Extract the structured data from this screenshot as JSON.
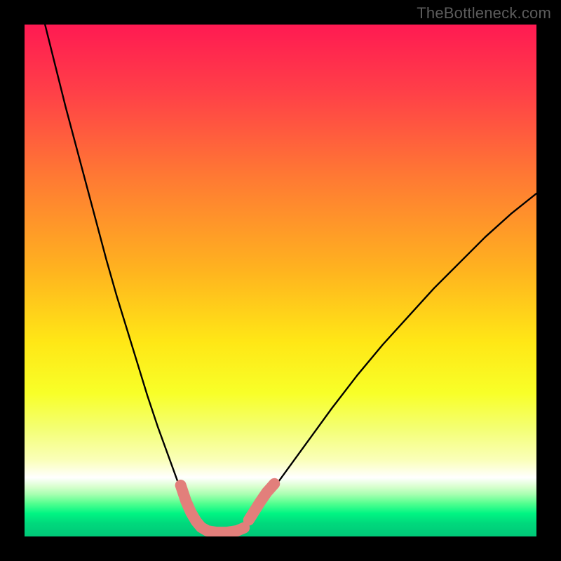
{
  "watermark": "TheBottleneck.com",
  "chart_data": {
    "type": "line",
    "title": "",
    "xlabel": "",
    "ylabel": "",
    "xlim": [
      0,
      100
    ],
    "ylim": [
      0,
      100
    ],
    "grid": false,
    "legend": false,
    "gradient_stops": [
      {
        "offset": 0.0,
        "color": "#ff1a52"
      },
      {
        "offset": 0.13,
        "color": "#ff3f48"
      },
      {
        "offset": 0.3,
        "color": "#ff7a33"
      },
      {
        "offset": 0.48,
        "color": "#ffb31f"
      },
      {
        "offset": 0.62,
        "color": "#ffe716"
      },
      {
        "offset": 0.72,
        "color": "#f8ff28"
      },
      {
        "offset": 0.79,
        "color": "#f4ff74"
      },
      {
        "offset": 0.85,
        "color": "#faffb8"
      },
      {
        "offset": 0.885,
        "color": "#ffffff"
      },
      {
        "offset": 0.903,
        "color": "#d8ffce"
      },
      {
        "offset": 0.918,
        "color": "#a6ffb0"
      },
      {
        "offset": 0.935,
        "color": "#56ff90"
      },
      {
        "offset": 0.955,
        "color": "#00f583"
      },
      {
        "offset": 0.975,
        "color": "#00d87c"
      },
      {
        "offset": 1.0,
        "color": "#00c878"
      }
    ],
    "series": [
      {
        "name": "left-curve",
        "stroke": "#000000",
        "x": [
          4,
          6,
          8,
          10,
          12,
          14,
          16,
          18,
          20,
          22,
          24,
          26,
          28,
          30,
          31.5,
          33,
          34.5
        ],
        "y": [
          100,
          92,
          84,
          76.5,
          69,
          61.5,
          54,
          47,
          40.5,
          34,
          27.5,
          21.5,
          16,
          10.5,
          6.5,
          3.5,
          1.5
        ]
      },
      {
        "name": "right-curve",
        "stroke": "#000000",
        "x": [
          43,
          45,
          48,
          52,
          56,
          60,
          65,
          70,
          75,
          80,
          85,
          90,
          95,
          100
        ],
        "y": [
          2,
          4.5,
          8.5,
          14,
          19.5,
          25,
          31.5,
          37.5,
          43,
          48.5,
          53.5,
          58.5,
          63,
          67
        ]
      },
      {
        "name": "bottom-flat",
        "stroke": "#000000",
        "x": [
          34.5,
          36,
          38,
          40,
          42,
          43
        ],
        "y": [
          1.5,
          0.6,
          0.3,
          0.3,
          0.6,
          2
        ]
      },
      {
        "name": "left-marker-band",
        "stroke": "#e27f7b",
        "thick": true,
        "x": [
          30.5,
          31.5,
          32.5,
          33.5,
          34.5,
          35.7,
          37.5,
          39.5,
          41.5,
          42.9
        ],
        "y": [
          10,
          7,
          4.7,
          3.0,
          1.8,
          1.1,
          0.8,
          0.8,
          1.1,
          1.7
        ]
      },
      {
        "name": "right-marker-band",
        "stroke": "#e27f7b",
        "thick": true,
        "x": [
          43.8,
          44.8,
          46,
          47.3,
          48.8
        ],
        "y": [
          3.2,
          4.8,
          6.7,
          8.6,
          10.3
        ]
      }
    ]
  }
}
